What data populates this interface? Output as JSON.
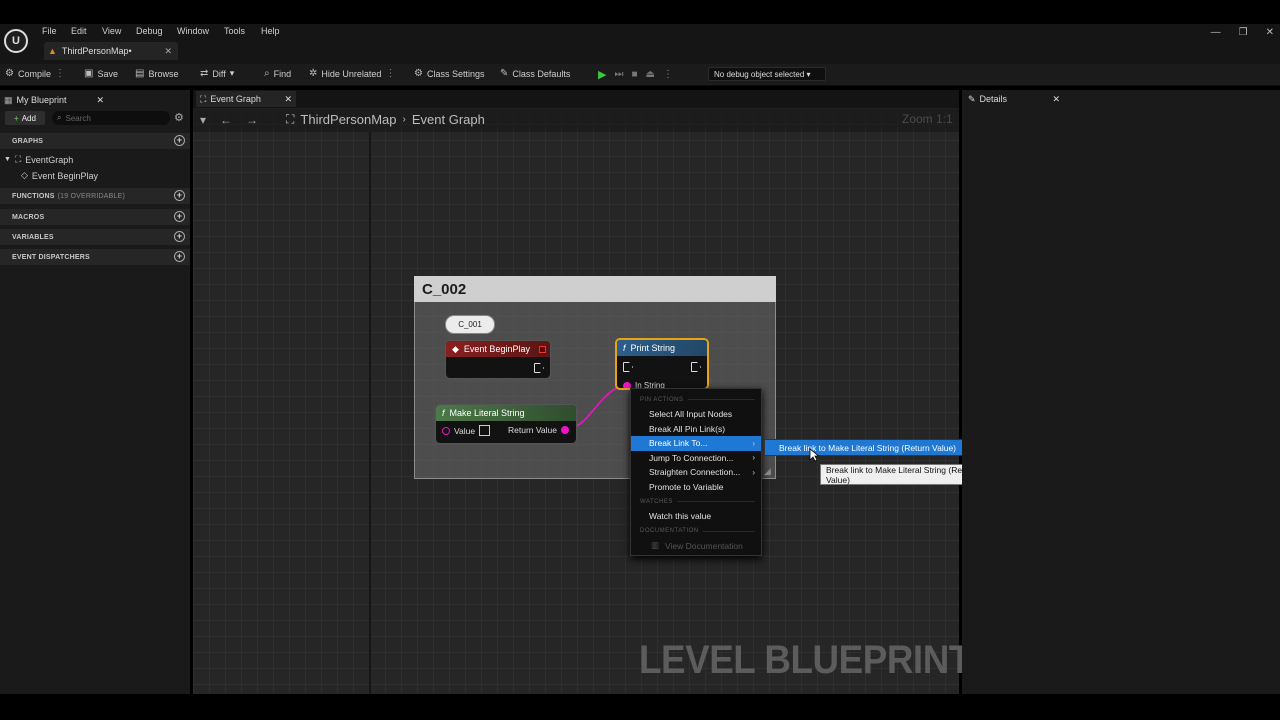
{
  "app": {
    "menu": [
      "File",
      "Edit",
      "View",
      "Debug",
      "Window",
      "Tools",
      "Help"
    ],
    "document_tab": "ThirdPersonMap•",
    "window_controls": [
      "—",
      "❐",
      "✕"
    ]
  },
  "toolbar": {
    "compile": "Compile",
    "save": "Save",
    "browse": "Browse",
    "diff": "Diff",
    "find": "Find",
    "hide_unrelated": "Hide Unrelated",
    "class_settings": "Class Settings",
    "class_defaults": "Class Defaults",
    "debug_object": "No debug object selected"
  },
  "my_blueprint": {
    "tab": "My Blueprint",
    "add": "Add",
    "search_placeholder": "Search",
    "sections": {
      "graphs": "GRAPHS",
      "functions": "FUNCTIONS",
      "functions_sub": "(19 OVERRIDABLE)",
      "macros": "MACROS",
      "variables": "VARIABLES",
      "dispatchers": "EVENT DISPATCHERS"
    },
    "graph_tree": {
      "graph": "EventGraph",
      "event": "Event BeginPlay"
    }
  },
  "graph": {
    "tab": "Event Graph",
    "breadcrumb": [
      "ThirdPersonMap",
      "Event Graph"
    ],
    "zoom": "Zoom 1:1",
    "watermark": "LEVEL BLUEPRINT",
    "comment_title": "C_002",
    "comment_bubble": "C_001",
    "nodes": {
      "begin_play": "Event BeginPlay",
      "print_string": "Print String",
      "in_string": "In String",
      "make_literal": "Make Literal String",
      "value_pin": "Value",
      "return_pin": "Return Value"
    }
  },
  "context_menu": {
    "sect_pin_actions": "PIN ACTIONS",
    "select_all_input": "Select All Input Nodes",
    "break_all": "Break All Pin Link(s)",
    "break_link_to": "Break Link To...",
    "jump_to": "Jump To Connection...",
    "straighten": "Straighten Connection...",
    "promote": "Promote to Variable",
    "sect_watches": "WATCHES",
    "watch": "Watch this value",
    "sect_documentation": "DOCUMENTATION",
    "view_docs": "View Documentation",
    "submenu_item": "Break link to Make Literal String (Return Value)",
    "tooltip": "Break link to Make Literal String (Return Value)"
  },
  "details": {
    "tab": "Details"
  },
  "colors": {
    "accent": "#1e78d4",
    "selected_node": "#e8a416",
    "string_pin": "#f012c8",
    "exec_green": "#5ab04a"
  }
}
